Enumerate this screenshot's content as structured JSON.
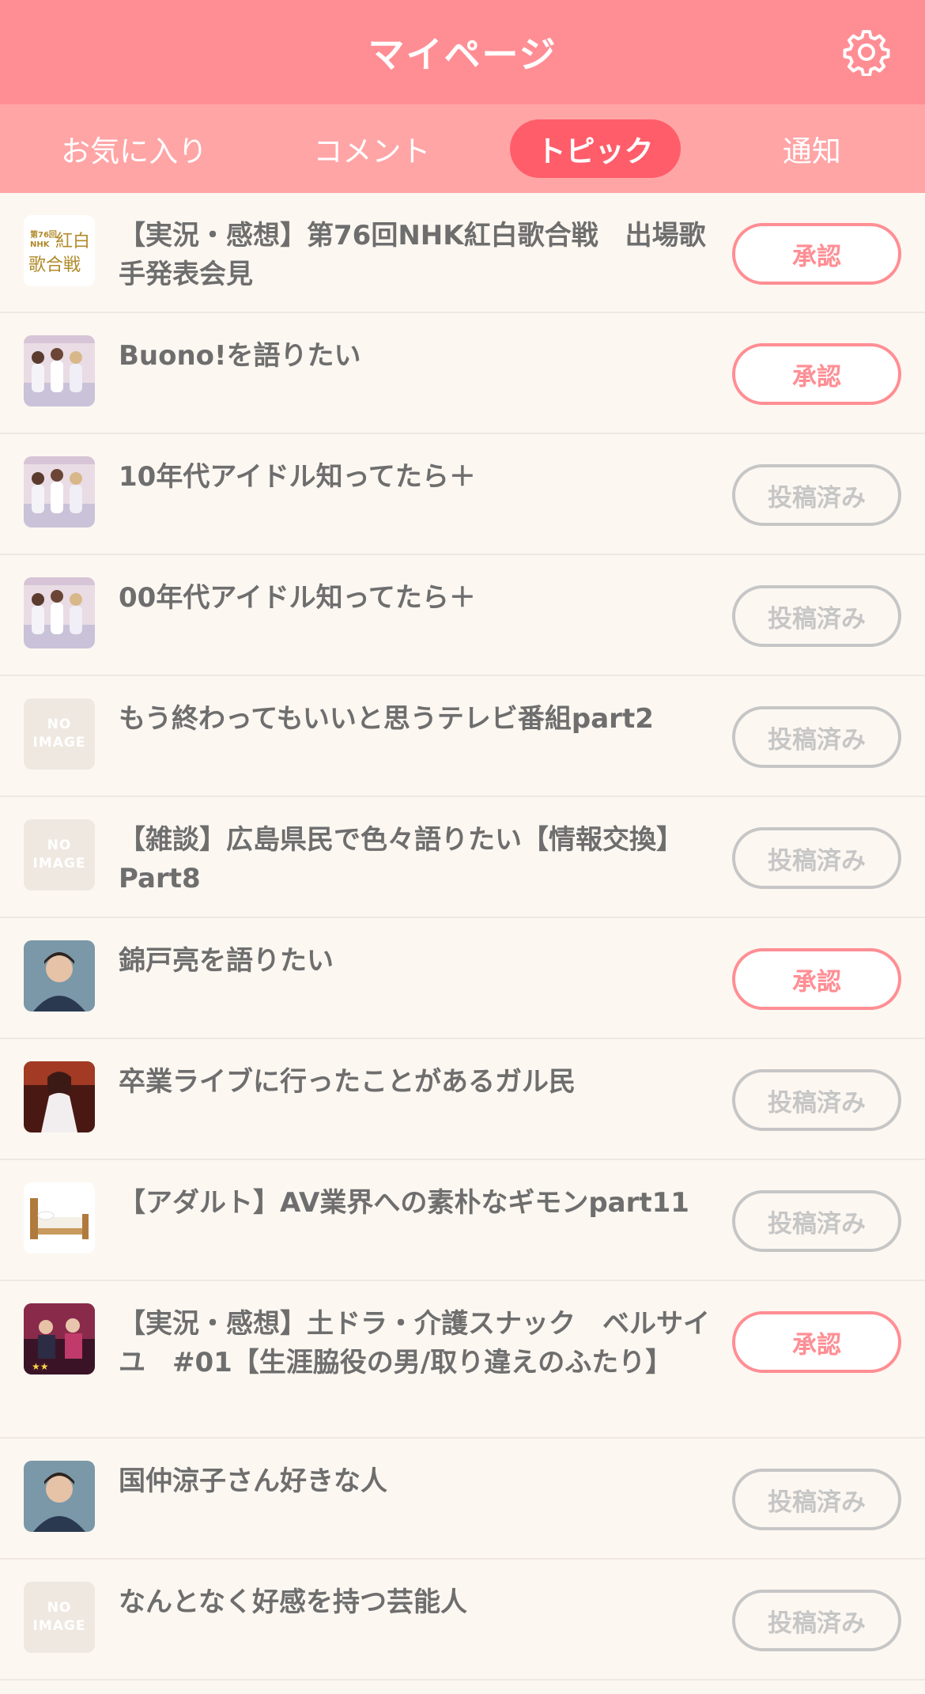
{
  "header": {
    "title": "マイページ"
  },
  "tabs": [
    {
      "label": "お気に入り"
    },
    {
      "label": "コメント"
    },
    {
      "label": "トピック",
      "active": true
    },
    {
      "label": "通知"
    }
  ],
  "colors": {
    "header": "#ff8e94",
    "tabs": "#ffa5a6",
    "active_tab": "#ff5d6a",
    "approve": "#ff8e94",
    "posted": "#c6c6c6"
  },
  "noimage": {
    "line1": "NO",
    "line2": "IMAGE"
  },
  "topics": [
    {
      "title": "【実況・感想】第76回NHK紅白歌合戦　出場歌手発表会見",
      "status": "承認",
      "thumb": "kohaku-logo"
    },
    {
      "title": "Buono!を語りたい",
      "status": "承認",
      "thumb": "group-photo"
    },
    {
      "title": "10年代アイドル知ってたら＋",
      "status": "投稿済み",
      "thumb": "group-photo"
    },
    {
      "title": "00年代アイドル知ってたら＋",
      "status": "投稿済み",
      "thumb": "group-photo"
    },
    {
      "title": "もう終わってもいいと思うテレビ番組part2",
      "status": "投稿済み",
      "thumb": "no-image"
    },
    {
      "title": "【雑談】広島県民で色々語りたい【情報交換】Part8",
      "status": "投稿済み",
      "thumb": "no-image"
    },
    {
      "title": "錦戸亮を語りたい",
      "status": "承認",
      "thumb": "portrait"
    },
    {
      "title": "卒業ライブに行ったことがあるガル民",
      "status": "投稿済み",
      "thumb": "stage-photo"
    },
    {
      "title": "【アダルト】AV業界への素朴なギモンpart11",
      "status": "投稿済み",
      "thumb": "bed-illustration"
    },
    {
      "title": "【実況・感想】土ドラ・介護スナック　ベルサイユ　#01【生涯脇役の男/取り違えのふたり】",
      "status": "承認",
      "thumb": "drama-poster"
    },
    {
      "title": "国仲涼子さん好きな人",
      "status": "投稿済み",
      "thumb": "portrait"
    },
    {
      "title": "なんとなく好感を持つ芸能人",
      "status": "投稿済み",
      "thumb": "no-image"
    }
  ]
}
